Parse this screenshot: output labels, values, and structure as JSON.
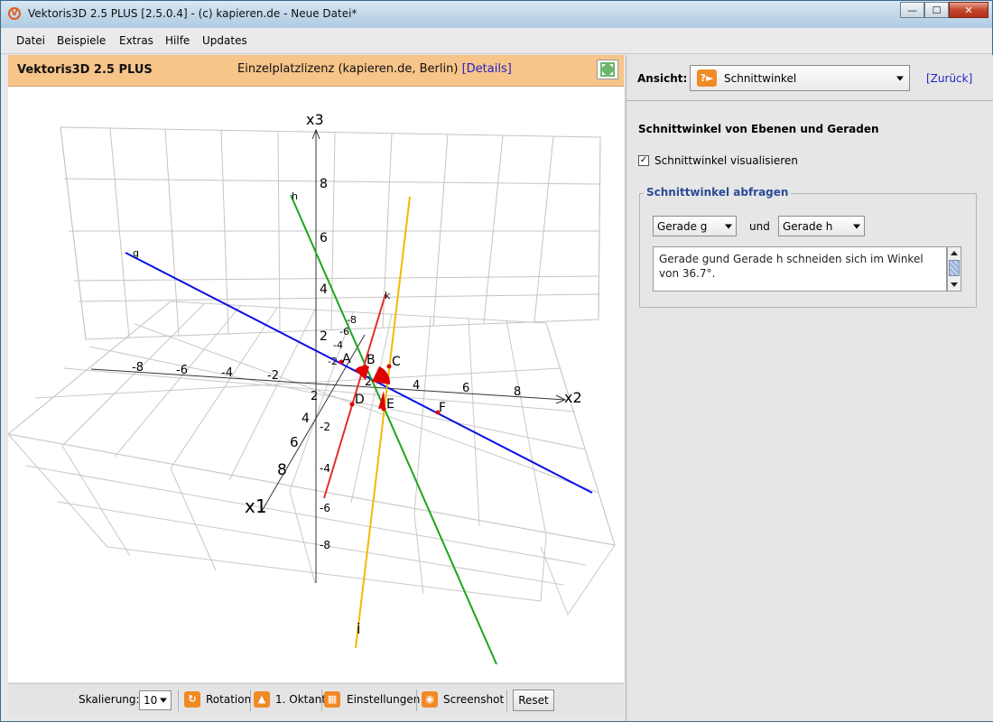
{
  "window": {
    "title": "Vektoris3D 2.5 PLUS [2.5.0.4] - (c) kapieren.de - Neue Datei*",
    "logo_letter": "V"
  },
  "menu": [
    "Datei",
    "Beispiele",
    "Extras",
    "Hilfe",
    "Updates"
  ],
  "header": {
    "title": "Vektoris3D 2.5 PLUS",
    "license": "Einzelplatzlizenz (kapieren.de, Berlin)",
    "details_link": "[Details]"
  },
  "plot": {
    "axes": {
      "x1": "x1",
      "x2": "x2",
      "x3": "x3"
    },
    "x2_ticks": [
      "-8",
      "-6",
      "-4",
      "-2",
      "2",
      "4",
      "6",
      "8"
    ],
    "x3_ticks": [
      "8",
      "6",
      "4",
      "2",
      "-2",
      "-4",
      "-6",
      "-8"
    ],
    "x1_ticks": [
      "-8",
      "-6",
      "-4",
      "-2",
      "2",
      "4",
      "6",
      "8"
    ],
    "lines": [
      {
        "name": "g",
        "color": "#0a10e0"
      },
      {
        "name": "h",
        "color": "#1da51d"
      },
      {
        "name": "i",
        "color": "#f5b800"
      },
      {
        "name": "k",
        "color": "#e03030"
      }
    ],
    "points": [
      "A",
      "B",
      "C",
      "D",
      "E",
      "F"
    ],
    "angle_color": "#e00000"
  },
  "toolbar": {
    "scale_label": "Skalierung:",
    "scale_value": "10",
    "rotation": "Rotation",
    "octant": "1. Oktant",
    "settings": "Einstellungen",
    "screenshot": "Screenshot",
    "reset": "Reset"
  },
  "right_panel": {
    "view_label": "Ansicht:",
    "view_value": "Schnittwinkel",
    "back_link": "[Zurück]",
    "heading": "Schnittwinkel von Ebenen und Geraden",
    "visualize_label": "Schnittwinkel visualisieren",
    "visualize_checked": true,
    "group_title": "Schnittwinkel abfragen",
    "select1": "Gerade g",
    "and_label": "und",
    "select2": "Gerade h",
    "result": "Gerade gund Gerade h schneiden sich im Winkel von 36.7°."
  }
}
